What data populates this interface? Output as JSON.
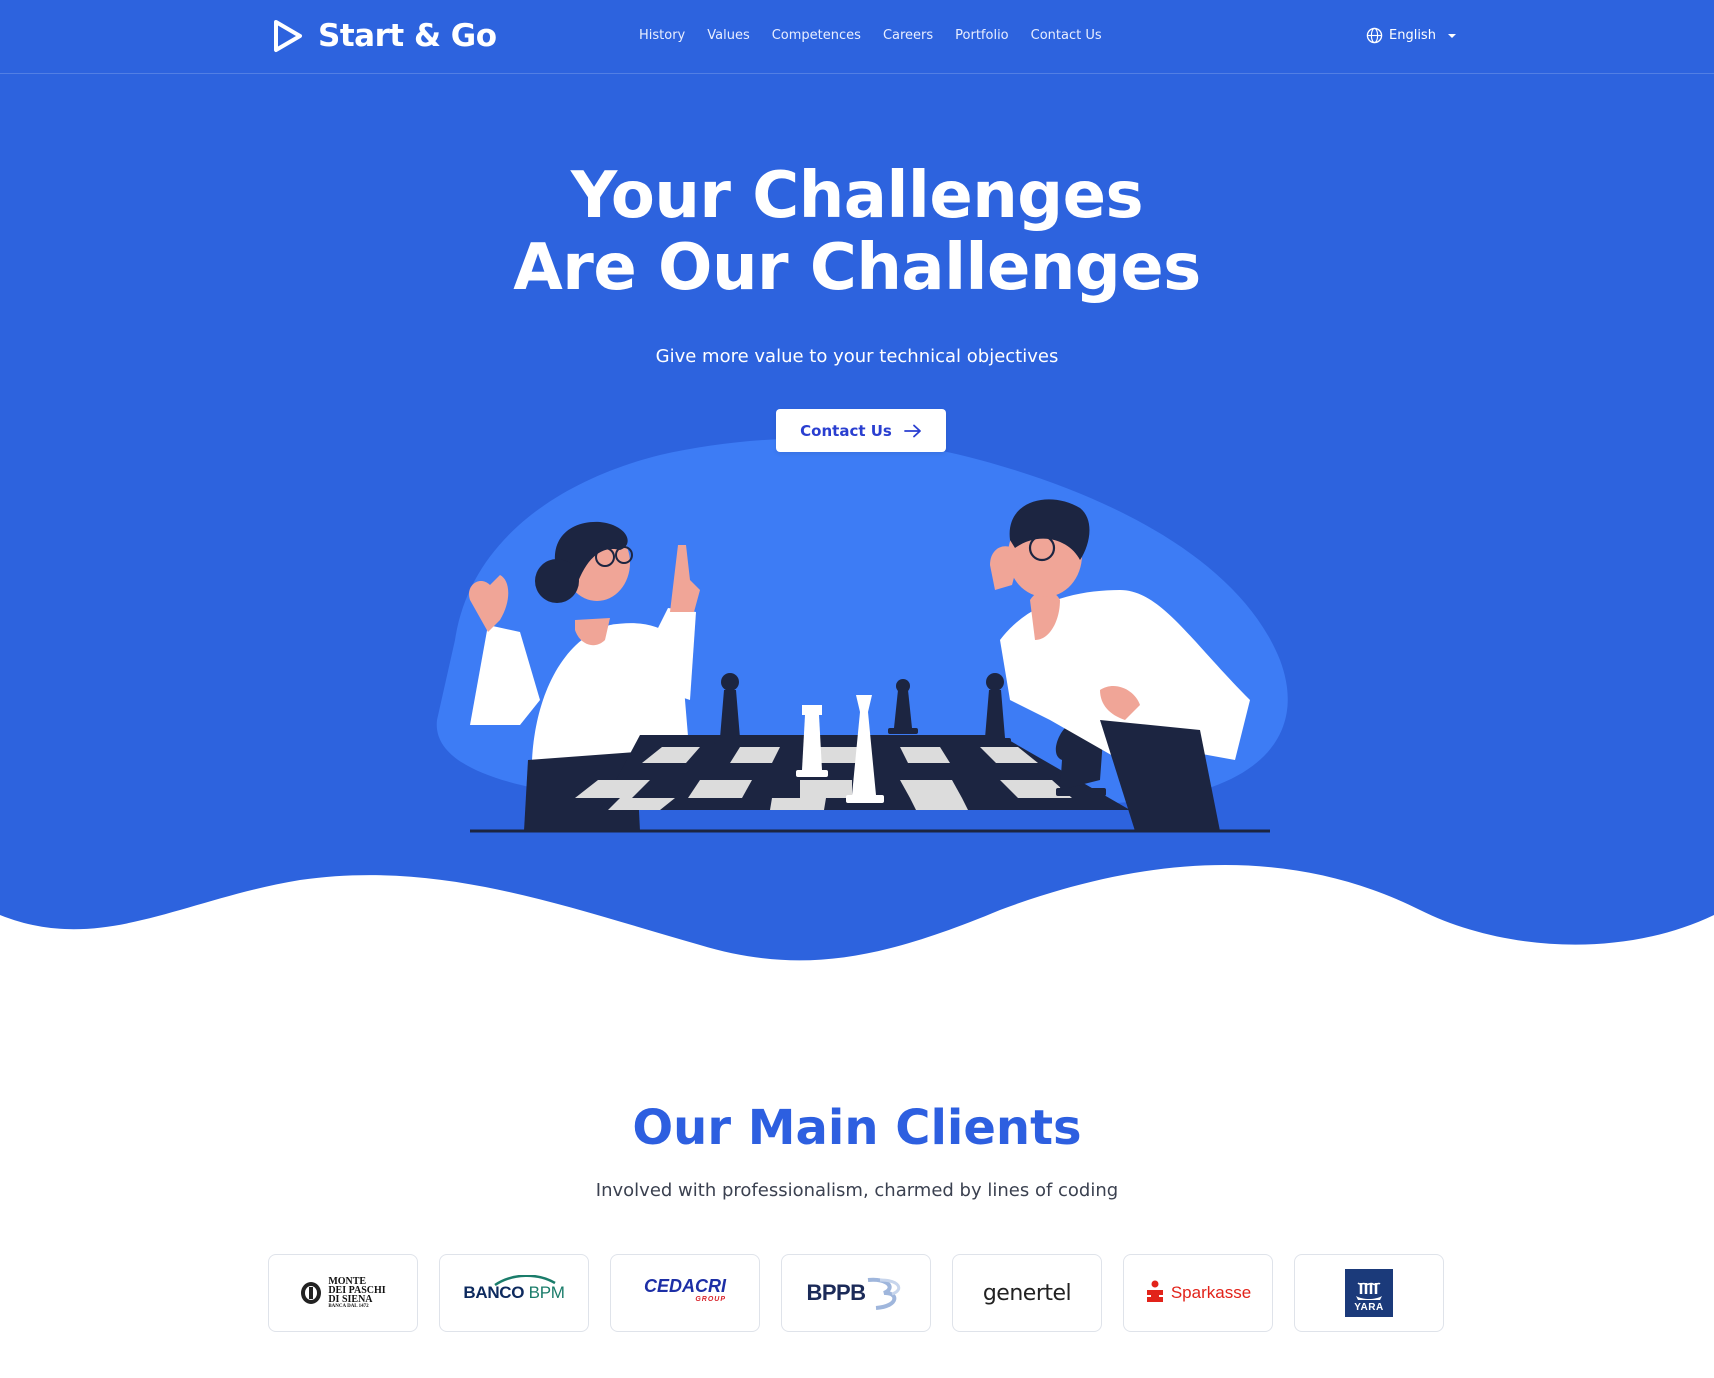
{
  "brand": {
    "name": "Start & Go"
  },
  "nav": {
    "items": [
      {
        "label": "History"
      },
      {
        "label": "Values"
      },
      {
        "label": "Competences"
      },
      {
        "label": "Careers"
      },
      {
        "label": "Portfolio"
      },
      {
        "label": "Contact Us"
      }
    ]
  },
  "language": {
    "selected": "English"
  },
  "hero": {
    "title_line1": "Your Challenges",
    "title_line2": "Are Our Challenges",
    "subtitle": "Give more value to your technical objectives",
    "cta_label": "Contact Us"
  },
  "clients": {
    "title": "Our Main Clients",
    "subtitle": "Involved with professionalism, charmed by lines of coding",
    "logos": [
      {
        "line1": "MONTE",
        "line2": "DEI PASCHI",
        "line3": "DI SIENA",
        "line4": "BANCA DAL 1472"
      },
      {
        "text1": "BANCO",
        "text2": "BPM"
      },
      {
        "text": "CEDACRI",
        "sub": "GROUP"
      },
      {
        "text": "BPPB"
      },
      {
        "text": "genertel"
      },
      {
        "text": "Sparkasse"
      },
      {
        "text": "YARA"
      }
    ]
  },
  "colors": {
    "hero_bg": "#2d63de",
    "blob": "#3d7cf5",
    "accent": "#2d5fe0",
    "dark_navy": "#1c2541"
  },
  "icons": [
    "play-triangle-logo-icon",
    "globe-icon",
    "caret-down-icon",
    "arrow-right-icon"
  ]
}
